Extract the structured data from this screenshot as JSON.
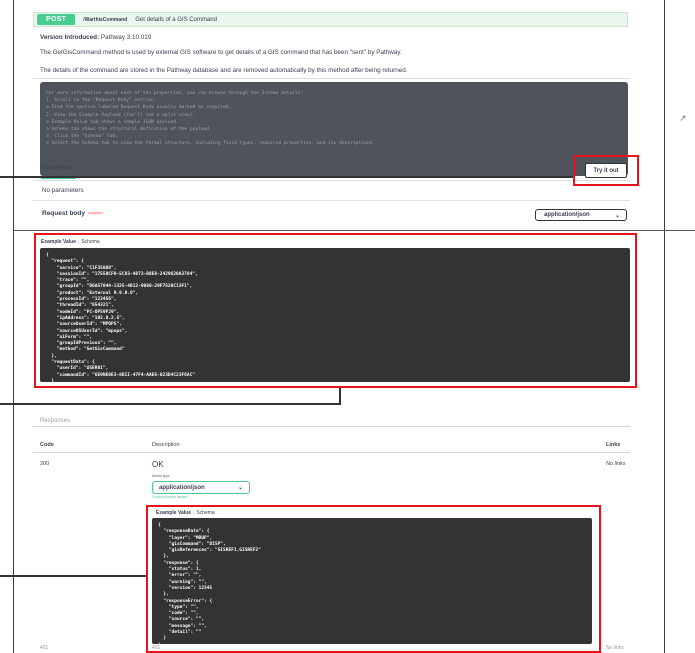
{
  "operation": {
    "method": "POST",
    "path": "/WarthisCommand",
    "summary": "Get details of a GIS Command",
    "version_label": "Version Introduced:",
    "version_value": "Pathway 3.10.019",
    "description_1": "The GetGisCommand method is used by external GIS software to get details of a GIS command that has been \"sent\" by Pathway.",
    "description_2": "The details of the command are stored in the Pathway database and are removed automatically by this method after being returned."
  },
  "instructions": [
    "For more information about each of the properties, you can browse through the Schema details:",
    "1. Scroll to the \"Request Body\" section.",
    "   a Find the section labeled Request Body usually marked as required.",
    "2. View the Example Payload (You'll see a split view):",
    "   a Example Value tab shows a sample JSON payload.",
    "   a Schema tab shows the structural definition of the payload.",
    "3. Click the \"Schema\" tab.",
    "   a Select the Schema tab to view the formal structure, including field types, required properties, and its descriptions."
  ],
  "parameters": {
    "tab_label": "Parameters",
    "try_it_out": "Try it out",
    "no_params": "No parameters"
  },
  "request_body": {
    "label": "Request body",
    "required": "required",
    "content_type": "application/json",
    "tab_example": "Example Value",
    "tab_schema": "Schema",
    "example_lines": [
      "{",
      "  \"request\": {",
      "    \"service\": \"C1F35008\",",
      "    \"sessionId\": \"17550CF9-5C83-4873-B8E8-2429620A3784\",",
      "    \"trace\": \"\",",
      "    \"groupId\": \"D6A57044-1325-4B12-9080-29F7520C13F1\",",
      "    \"product\": \"External 9.9.0.0\",",
      "    \"processId\": \"123456\",",
      "    \"threadId\": \"654321\",",
      "    \"nodeId\": \"PC-OP59PJ9\",",
      "    \"ipAddress\": \"192.0.2.5\",",
      "    \"sourceUserId\": \"MPOPS\",",
      "    \"sourceOSUserId\": \"mpops\",",
      "    \"uiForm\": \"\",",
      "    \"groupIdPrevious\": \"\",",
      "    \"method\": \"GetGisCommand\"",
      "  },",
      "  \"requestData\": {",
      "    \"userId\": \"USER01\",",
      "    \"commandId\": \"6E9NE0E3-8B1I-47F4-AAE6-023D4C23F6AC\"",
      "  }",
      "}"
    ]
  },
  "responses": {
    "title": "Responses",
    "col_code": "Code",
    "col_description": "Description",
    "col_links": "Links",
    "code": "200",
    "description": "OK",
    "links": "No links",
    "media_type_label": "Media type",
    "media_type": "application/json",
    "accept_hint": "Controls Accept header.",
    "tab_example": "Example Value",
    "tab_schema": "Schema",
    "example_lines": [
      "{",
      "  \"responseData\": {",
      "    \"layer\": \"MBUP\",",
      "    \"gisCommand\": \"DISP\",",
      "    \"gisReferences\": \"GISREF1,GISREF2\"",
      "  },",
      "  \"response\": {",
      "    \"status\": 1,",
      "    \"error\": \"\",",
      "    \"warning\": \"\",",
      "    \"version\": 12345",
      "  },",
      "  \"responseError\": {",
      "    \"type\": \"\",",
      "    \"code\": \"\",",
      "    \"source\": \"\",",
      "    \"message\": \"\",",
      "    \"detail\": \"\"",
      "  }",
      "}"
    ],
    "next_code": "401",
    "next_description": "401",
    "next_links": "No links"
  },
  "icons": {
    "external_link": "external-link-icon",
    "chevron": "chevron-down-icon"
  },
  "colors": {
    "post": "#49cc90",
    "annotation": "#e8131b",
    "code_bg": "#333333",
    "required": "#f93e3e"
  }
}
